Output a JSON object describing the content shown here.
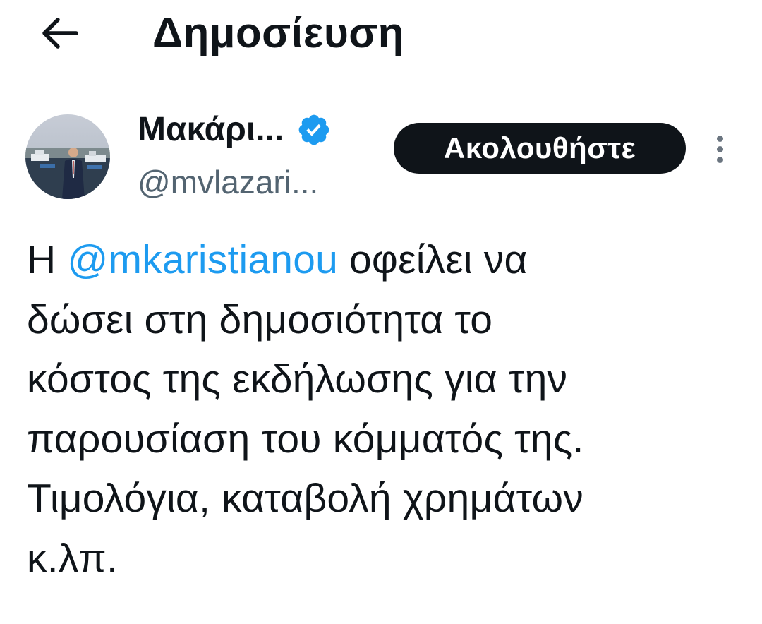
{
  "header": {
    "back_icon": "arrow-left-icon",
    "title": "Δημοσίευση"
  },
  "author": {
    "display_name": "Μακάρι...",
    "handle": "@mvlazari...",
    "verified_icon": "verified-badge-icon",
    "verified_color": "#1d9bf0"
  },
  "actions": {
    "follow_label": "Ακολουθήστε",
    "more_icon": "more-vertical-icon"
  },
  "tweet": {
    "prefix": "Η ",
    "mention": "@mkaristianou",
    "line1_rest": " οφείλει να",
    "line2": "δώσει στη δημοσιότητα το",
    "line3": "κόστος της εκδήλωσης για την",
    "line4": "παρουσίαση του κόμματός της.",
    "line5": "Τιμολόγια, καταβολή χρημάτων",
    "line6": "κ.λπ."
  },
  "colors": {
    "accent": "#1d9bf0",
    "text": "#0f1419",
    "secondary": "#536471",
    "button_bg": "#0f1419"
  }
}
